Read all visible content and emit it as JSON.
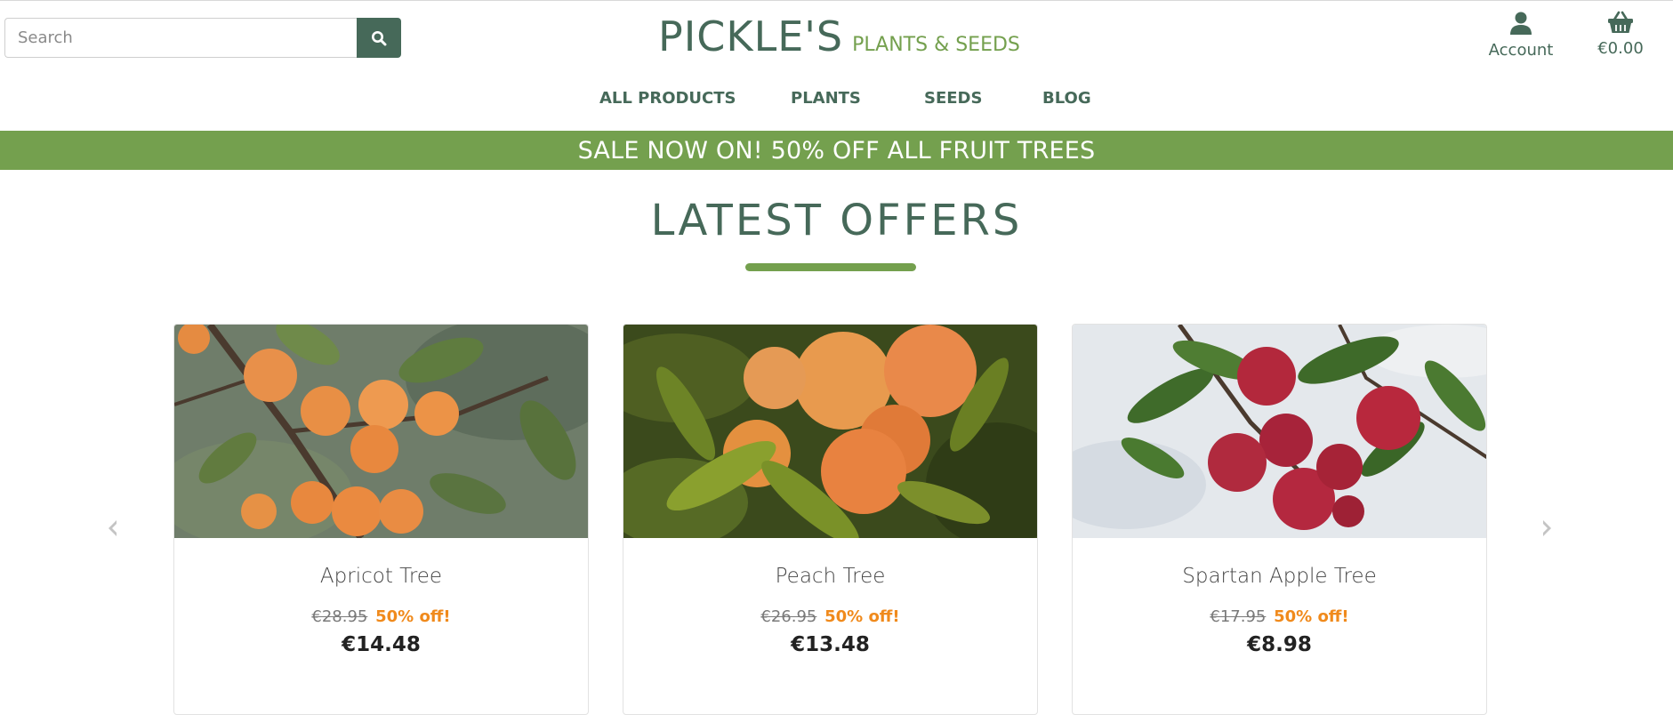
{
  "search": {
    "placeholder": "Search",
    "icon": "search-icon"
  },
  "logo": {
    "main": "PICKLE'S",
    "sub": "PLANTS & SEEDS"
  },
  "account": {
    "label": "Account",
    "icon": "user-icon"
  },
  "basket": {
    "label": "€0.00",
    "icon": "basket-icon"
  },
  "nav": {
    "items": [
      {
        "label": "ALL PRODUCTS"
      },
      {
        "label": "PLANTS"
      },
      {
        "label": "SEEDS"
      },
      {
        "label": "BLOG"
      }
    ]
  },
  "banner": {
    "text": "SALE NOW ON! 50% OFF ALL FRUIT TREES"
  },
  "offers": {
    "title": "LATEST OFFERS",
    "cards": [
      {
        "name": "Apricot Tree",
        "old_price": "€28.95",
        "discount": "50% off!",
        "price": "€14.48"
      },
      {
        "name": "Peach Tree",
        "old_price": "€26.95",
        "discount": "50% off!",
        "price": "€13.48"
      },
      {
        "name": "Spartan Apple Tree",
        "old_price": "€17.95",
        "discount": "50% off!",
        "price": "€8.98"
      }
    ]
  },
  "colors": {
    "brand_dark": "#466959",
    "brand_green": "#74a04e",
    "discount_orange": "#f08a1c"
  }
}
